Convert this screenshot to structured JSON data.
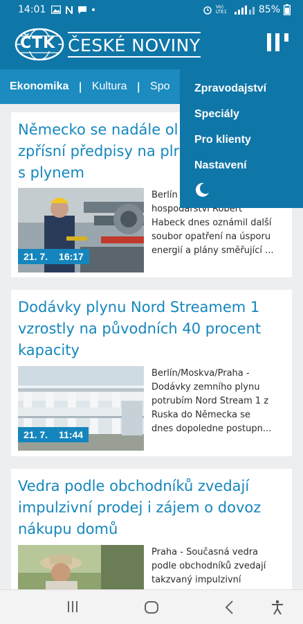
{
  "status_bar": {
    "time": "14:01",
    "network_label": "Vo) LTE1",
    "battery": "85%"
  },
  "header": {
    "logo_badge": "ČTK",
    "logo_text": "ČESKÉ NOVINY"
  },
  "categories": [
    "Ekonomika",
    "Kultura",
    "Spo"
  ],
  "menu": {
    "items": [
      "Zpravodajství",
      "Speciály",
      "Pro klienty",
      "Nastavení"
    ]
  },
  "articles": [
    {
      "title_lines": [
        "Německo se nadále ol",
        "zpřísní předpisy na plr",
        "s plynem"
      ],
      "date": "21. 7.",
      "time": "16:17",
      "excerpt_lines": [
        "Berlín",
        "hospodářství Robert",
        "Habeck dnes oznámil další",
        "soubor opatření na úsporu",
        "energií a plány směřující ..."
      ]
    },
    {
      "title_lines": [
        "Dodávky plynu Nord Streamem 1",
        "vzrostly na původních 40 procent",
        "kapacity"
      ],
      "date": "21. 7.",
      "time": "11:44",
      "excerpt_lines": [
        "Berlín/Moskva/Praha -",
        "Dodávky zemního plynu",
        "potrubím Nord Stream 1 z",
        "Ruska do Německa se",
        "dnes dopoledne postupn..."
      ]
    },
    {
      "title_lines": [
        "Vedra podle obchodníků zvedají",
        "impulzivní prodej i zájem o dovoz",
        "nákupu domů"
      ],
      "date": "",
      "time": "",
      "excerpt_lines": [
        "Praha - Současná vedra",
        "podle obchodníků zvedají",
        "takzvaný impulzivní"
      ]
    }
  ],
  "colors": {
    "header": "#0f76a8",
    "category_bar": "#1b8bc0",
    "title_blue": "#1586bd"
  }
}
